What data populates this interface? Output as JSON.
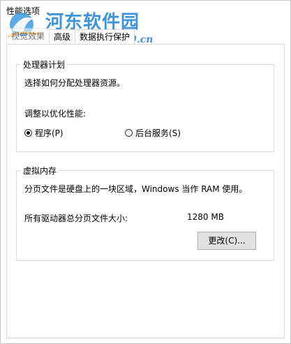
{
  "window": {
    "title": "性能选项"
  },
  "watermark": {
    "name": "河东软件园",
    "url": "www.pc0359.cn",
    "color": "#2f8ad6"
  },
  "tabs": [
    {
      "label": "视觉效果",
      "active": true
    },
    {
      "label": "高级",
      "active": false
    },
    {
      "label": "数据执行保护",
      "active": false
    }
  ],
  "processor_scheduling": {
    "legend": "处理器计划",
    "description": "选择如何分配处理器资源。",
    "adjust_label": "调整以优化性能:",
    "options": [
      {
        "label": "程序(P)",
        "checked": true
      },
      {
        "label": "后台服务(S)",
        "checked": false
      }
    ]
  },
  "virtual_memory": {
    "legend": "虚拟内存",
    "description": "分页文件是硬盘上的一块区域，Windows 当作 RAM 使用。",
    "total_label": "所有驱动器总分页文件大小:",
    "total_value": "1280 MB",
    "change_button": "更改(C)..."
  }
}
